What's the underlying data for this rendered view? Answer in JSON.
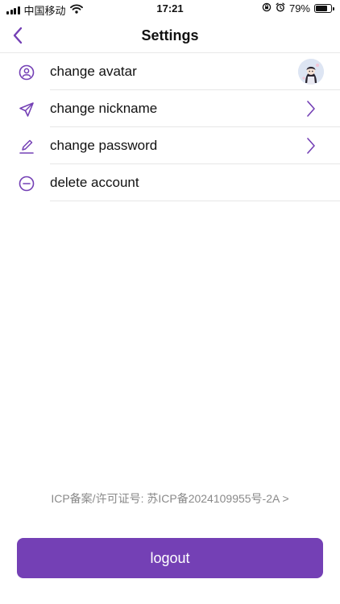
{
  "status_bar": {
    "carrier": "中国移动",
    "time": "17:21",
    "battery_percent": "79%",
    "battery_level": 0.79,
    "icons": [
      "signal-icon",
      "wifi-icon",
      "orientation-lock-icon",
      "alarm-icon",
      "battery-icon"
    ]
  },
  "nav": {
    "title": "Settings",
    "back_icon": "chevron-left-icon"
  },
  "settings": {
    "items": [
      {
        "label": "change avatar",
        "icon": "user-circle-icon",
        "trailing": "avatar"
      },
      {
        "label": "change nickname",
        "icon": "send-icon",
        "trailing": "chevron-right-icon"
      },
      {
        "label": "change password",
        "icon": "edit-icon",
        "trailing": "chevron-right-icon"
      },
      {
        "label": "delete account",
        "icon": "minus-circle-icon",
        "trailing": ""
      }
    ]
  },
  "footer": {
    "icp_text": "ICP备案/许可证号: 苏ICP备2024109955号-2A >"
  },
  "logout": {
    "label": "logout"
  },
  "colors": {
    "accent": "#7440b5",
    "icp_text": "#8a8a8a",
    "divider": "#e6e6e6"
  }
}
